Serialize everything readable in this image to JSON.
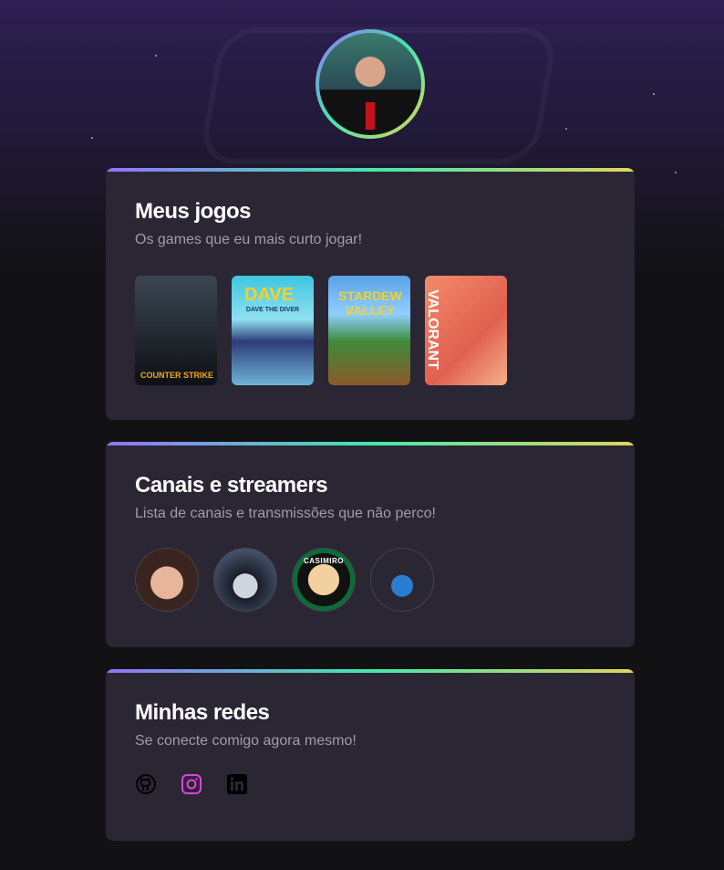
{
  "colors": {
    "gradient": [
      "#9572fc",
      "#43e7ad",
      "#e2d45c"
    ],
    "card_bg": "#2a2634",
    "page_bg": "#121214",
    "instagram": "#e53fe0"
  },
  "profile": {
    "avatar": "profile-photo"
  },
  "games_section": {
    "title": "Meus jogos",
    "subtitle": "Os games que eu mais curto jogar!",
    "games": [
      {
        "name": "Counter-Strike",
        "label": "COUNTER STRIKE"
      },
      {
        "name": "Dave the Diver",
        "label": "DAVE"
      },
      {
        "name": "Stardew Valley",
        "label": "STARDEW VALLEY"
      },
      {
        "name": "Valorant",
        "label": "VALORANT"
      }
    ]
  },
  "streamers_section": {
    "title": "Canais e streamers",
    "subtitle": "Lista de canais e transmissões que não perco!",
    "streamers": [
      "streamer-1",
      "streamer-2",
      "Casimiro",
      "streamer-4"
    ]
  },
  "social_section": {
    "title": "Minhas redes",
    "subtitle": "Se conecte comigo agora mesmo!",
    "links": [
      {
        "icon": "github-icon"
      },
      {
        "icon": "instagram-icon"
      },
      {
        "icon": "linkedin-icon"
      }
    ]
  }
}
